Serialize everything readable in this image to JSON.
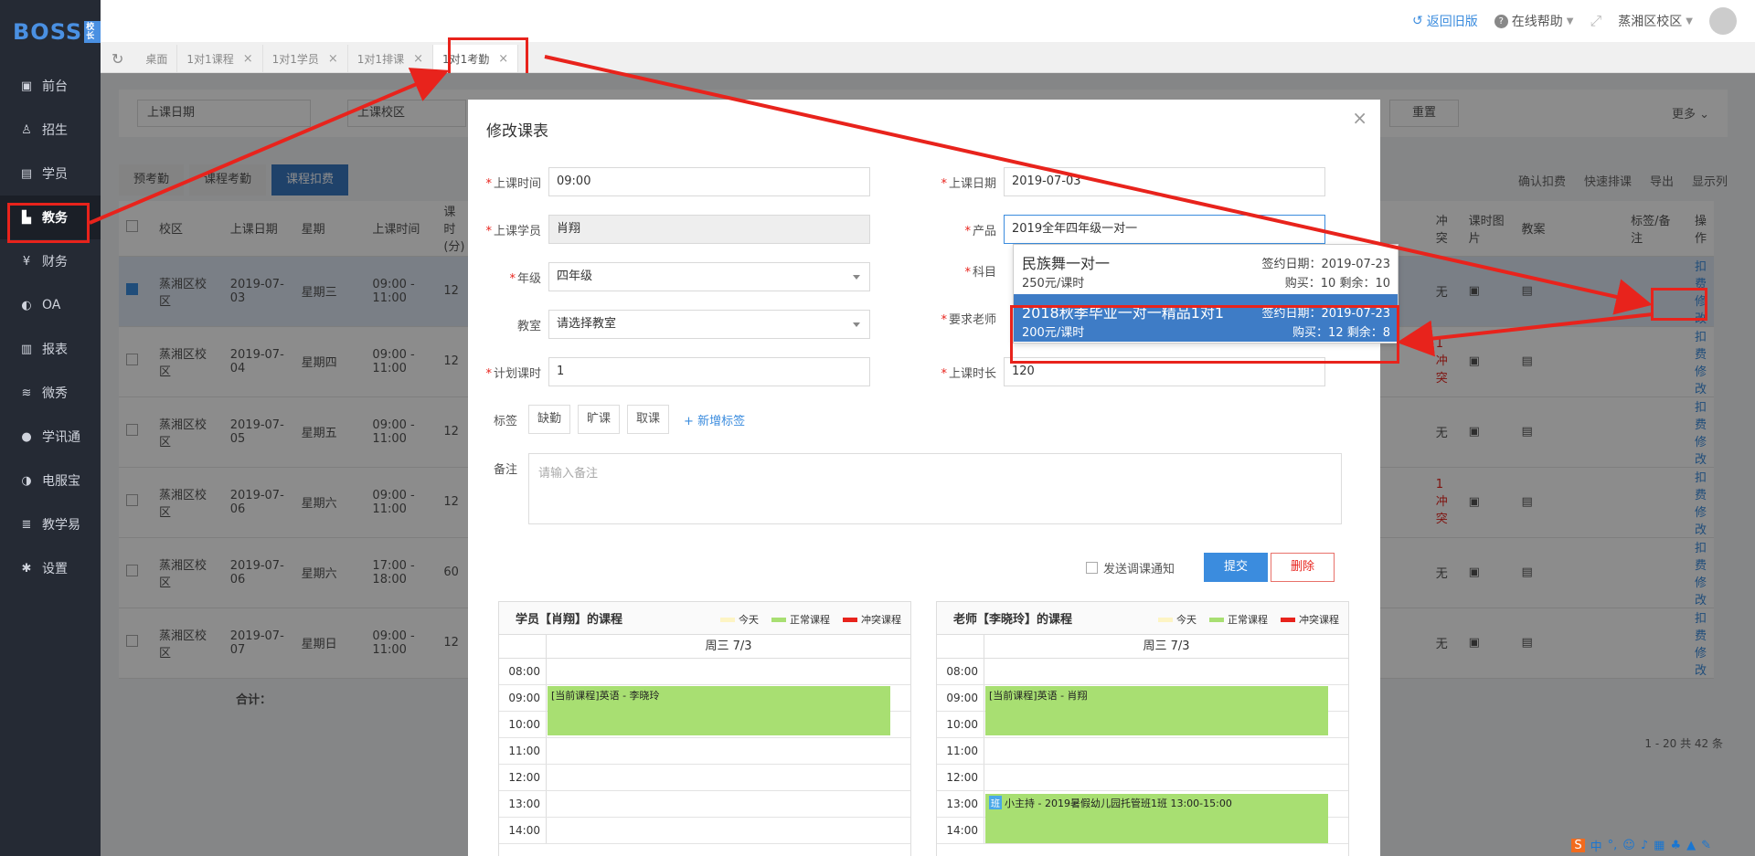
{
  "app": {
    "logo": "BOSS",
    "logo_badge": "校长"
  },
  "sidebar": {
    "items": [
      {
        "label": "前台",
        "icon": "calendar-icon"
      },
      {
        "label": "招生",
        "icon": "user-plus-icon"
      },
      {
        "label": "学员",
        "icon": "student-icon"
      },
      {
        "label": "教务",
        "icon": "academic-icon"
      },
      {
        "label": "财务",
        "icon": "yen-icon"
      },
      {
        "label": "OA",
        "icon": "toggle-icon"
      },
      {
        "label": "报表",
        "icon": "bar-chart-icon"
      },
      {
        "label": "微秀",
        "icon": "wechat-icon"
      },
      {
        "label": "学讯通",
        "icon": "location-icon"
      },
      {
        "label": "电服宝",
        "icon": "phone-icon"
      },
      {
        "label": "教学易",
        "icon": "book-icon"
      },
      {
        "label": "设置",
        "icon": "gear-icon"
      }
    ]
  },
  "header": {
    "back_old": "返回旧版",
    "help": "在线帮助",
    "campus": "蒸湘区校区"
  },
  "tabs": [
    {
      "label": "桌面",
      "closable": false
    },
    {
      "label": "1对1课程",
      "closable": true
    },
    {
      "label": "1对1学员",
      "closable": true
    },
    {
      "label": "1对1排课",
      "closable": true
    },
    {
      "label": "1对1考勤",
      "closable": true,
      "active": true
    }
  ],
  "background": {
    "filter_date": "上课日期",
    "filter_campus": "上课校区",
    "reset": "重置",
    "more": "更多",
    "steps": [
      "预考勤",
      "课程考勤",
      "课程扣费"
    ],
    "tools": [
      "确认扣费",
      "快速排课",
      "导出",
      "显示列"
    ],
    "columns": [
      "校区",
      "上课日期",
      "星期",
      "上课时间",
      "课时(分)",
      "冲突",
      "课时图片",
      "教案",
      "标签/备注",
      "操作"
    ],
    "rows": [
      {
        "campus": "蒸湘区校区",
        "date": "2019-07-03",
        "week": "星期三",
        "time": "09:00 - 11:00",
        "mins": "12",
        "conflict": "无",
        "ops": [
          "扣费",
          "修改"
        ]
      },
      {
        "campus": "蒸湘区校区",
        "date": "2019-07-04",
        "week": "星期四",
        "time": "09:00 - 11:00",
        "mins": "12",
        "conflict": "1冲突",
        "ops": [
          "扣费",
          "修改"
        ]
      },
      {
        "campus": "蒸湘区校区",
        "date": "2019-07-05",
        "week": "星期五",
        "time": "09:00 - 11:00",
        "mins": "12",
        "conflict": "无",
        "ops": [
          "扣费",
          "修改"
        ]
      },
      {
        "campus": "蒸湘区校区",
        "date": "2019-07-06",
        "week": "星期六",
        "time": "09:00 - 11:00",
        "mins": "12",
        "conflict": "1冲突",
        "ops": [
          "扣费",
          "修改"
        ]
      },
      {
        "campus": "蒸湘区校区",
        "date": "2019-07-06",
        "week": "星期六",
        "time": "17:00 - 18:00",
        "mins": "60",
        "conflict": "无",
        "ops": [
          "扣费",
          "修改"
        ]
      },
      {
        "campus": "蒸湘区校区",
        "date": "2019-07-07",
        "week": "星期日",
        "time": "09:00 - 11:00",
        "mins": "12",
        "conflict": "无",
        "ops": [
          "扣费",
          "修改"
        ]
      }
    ],
    "total": "合计：",
    "pagination": "1 - 20  共 42 条"
  },
  "modal": {
    "title": "修改课表",
    "fields": {
      "class_time_label": "上课时间",
      "class_time": "09:00",
      "class_date_label": "上课日期",
      "class_date": "2019-07-03",
      "student_label": "上课学员",
      "student": "肖翔",
      "product_label": "产品",
      "product": "2019全年四年级一对一",
      "grade_label": "年级",
      "grade": "四年级",
      "subject_label": "科目",
      "room_label": "教室",
      "room_placeholder": "请选择教室",
      "teacher_label": "要求老师",
      "plan_hours_label": "计划课时",
      "plan_hours": "1",
      "duration_label": "上课时长",
      "duration": "120"
    },
    "tags_label": "标签",
    "tags": [
      "缺勤",
      "旷课",
      "取课"
    ],
    "add_tag": "+ 新增标签",
    "remark_label": "备注",
    "remark_placeholder": "请输入备注",
    "notify": "发送调课通知",
    "submit": "提交",
    "delete": "删除",
    "dropdown": [
      {
        "name": "民族舞一对一",
        "date": "签约日期：2019-07-23",
        "price": "250元/课时",
        "buy": "购买：10  剩余：10"
      },
      {
        "name": "2018秋季毕业一对一精品1对1",
        "date": "签约日期：2019-07-23",
        "price": "200元/课时",
        "buy": "购买：12  剩余：8"
      }
    ],
    "schedules": [
      {
        "title": "学员【肖翔】的课程",
        "day": "周三 7/3",
        "events": [
          {
            "text": "[当前课程]英语 - 李晓玲"
          }
        ]
      },
      {
        "title": "老师【李晓玲】的课程",
        "day": "周三 7/3",
        "events": [
          {
            "text": "[当前课程]英语 - 肖翔"
          },
          {
            "badge": "班",
            "text": "小主持 - 2019暑假幼儿园托管班1班 13:00-15:00"
          }
        ]
      }
    ],
    "legend": [
      "今天",
      "正常课程",
      "冲突课程"
    ],
    "hours": [
      "08:00",
      "09:00",
      "10:00",
      "11:00",
      "12:00",
      "13:00",
      "14:00"
    ]
  },
  "colors": {
    "accent": "#3b8cde",
    "highlight": "#3e7cc6",
    "today": "#fdf4c4",
    "normal": "#a8df72",
    "conflict": "#e8231c",
    "annotation": "#e8231c"
  }
}
